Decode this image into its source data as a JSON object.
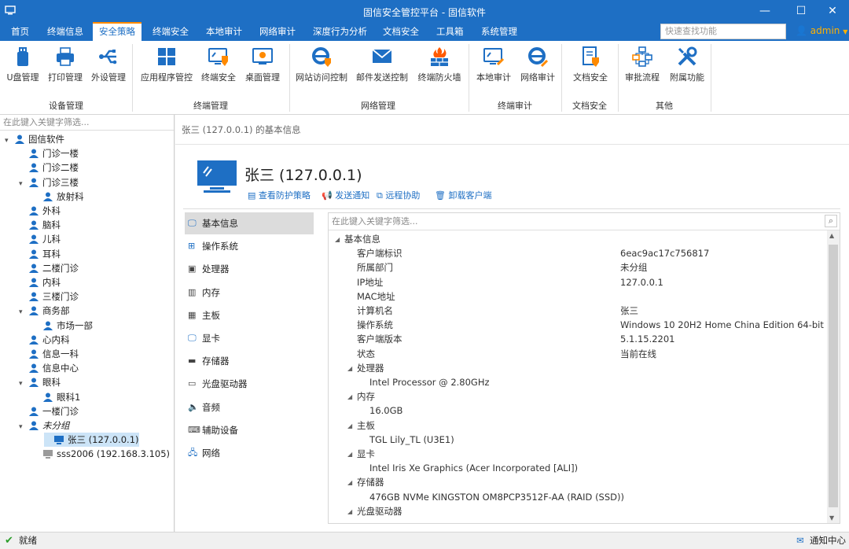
{
  "titlebar": {
    "title": "固信安全管控平台 - 固信软件",
    "minimize_icon": "minimize-icon",
    "maximize_icon": "maximize-icon",
    "close_icon": "close-icon"
  },
  "menu": {
    "items": [
      "首页",
      "终端信息",
      "安全策略",
      "终端安全",
      "本地审计",
      "网络审计",
      "深度行为分析",
      "文档安全",
      "工具箱",
      "系统管理"
    ],
    "active_index": 2,
    "search_placeholder": "快速查找功能",
    "user": "admin"
  },
  "ribbon": {
    "buttons": [
      {
        "label": "U盘管理",
        "icon": "usb-drive-icon"
      },
      {
        "label": "打印管理",
        "icon": "printer-icon"
      },
      {
        "label": "外设管理",
        "icon": "usb-icon"
      },
      {
        "label": "应用程序管控",
        "icon": "app-grid-icon"
      },
      {
        "label": "终端安全",
        "icon": "monitor-shield-icon"
      },
      {
        "label": "桌面管理",
        "icon": "desktop-icon"
      },
      {
        "label": "网站访问控制",
        "icon": "ie-shield-icon"
      },
      {
        "label": "邮件发送控制",
        "icon": "mail-icon"
      },
      {
        "label": "终端防火墙",
        "icon": "firewall-icon"
      },
      {
        "label": "本地审计",
        "icon": "monitor-pen-icon"
      },
      {
        "label": "网络审计",
        "icon": "ie-pen-icon"
      },
      {
        "label": "文档安全",
        "icon": "document-shield-icon"
      },
      {
        "label": "审批流程",
        "icon": "flow-icon"
      },
      {
        "label": "附属功能",
        "icon": "tools-icon"
      }
    ],
    "groups": [
      "设备管理",
      "终端管理",
      "网络管理",
      "终端审计",
      "文档安全",
      "其他"
    ]
  },
  "tree": {
    "filter_placeholder": "在此键入关键字筛选...",
    "nodes": [
      "固信软件",
      "门诊一楼",
      "门诊二楼",
      "门诊三楼",
      "放射科",
      "外科",
      "脑科",
      "儿科",
      "耳科",
      "二楼门诊",
      "内科",
      "三楼门诊",
      "商务部",
      "市场一部",
      "心内科",
      "信息一科",
      "信息中心",
      "眼科",
      "眼科1",
      "一楼门诊",
      "未分组",
      "张三 (127.0.0.1)",
      "sss2006 (192.168.3.105)"
    ]
  },
  "main": {
    "breadcrumb": "张三 (127.0.0.1) 的基本信息",
    "host_title": "张三 (127.0.0.1)",
    "actions": [
      "查看防护策略",
      "发送通知",
      "远程协助",
      "卸载客户端"
    ],
    "categories": [
      "基本信息",
      "操作系统",
      "处理器",
      "内存",
      "主板",
      "显卡",
      "存储器",
      "光盘驱动器",
      "音频",
      "辅助设备",
      "网络"
    ],
    "detail_filter_placeholder": "在此键入关键字筛选...",
    "basic_section": "基本信息",
    "basic": [
      {
        "k": "客户端标识",
        "v": "6eac9ac17c756817"
      },
      {
        "k": "所属部门",
        "v": "未分组"
      },
      {
        "k": "IP地址",
        "v": "127.0.0.1"
      },
      {
        "k": "MAC地址",
        "v": ""
      },
      {
        "k": "计算机名",
        "v": "张三"
      },
      {
        "k": "操作系统",
        "v": "Windows 10 20H2 Home China Edition 64-bit"
      },
      {
        "k": "客户端版本",
        "v": "5.1.15.2201"
      },
      {
        "k": "状态",
        "v": "当前在线"
      }
    ],
    "hardware": [
      {
        "k": "处理器",
        "v": "Intel Processor @ 2.80GHz"
      },
      {
        "k": "内存",
        "v": "16.0GB"
      },
      {
        "k": "主板",
        "v": "TGL Lily_TL (U3E1)"
      },
      {
        "k": "显卡",
        "v": "Intel Iris Xe Graphics (Acer Incorporated [ALI])"
      },
      {
        "k": "存储器",
        "v": "476GB NVMe KINGSTON OM8PCP3512F-AA (RAID (SSD))"
      },
      {
        "k": "光盘驱动器",
        "v": ""
      }
    ]
  },
  "status": {
    "left": "就绪",
    "right": "通知中心"
  },
  "colors": {
    "accent": "#1e6fc4",
    "orange": "#ff8a00",
    "selected": "#cce4f7"
  }
}
